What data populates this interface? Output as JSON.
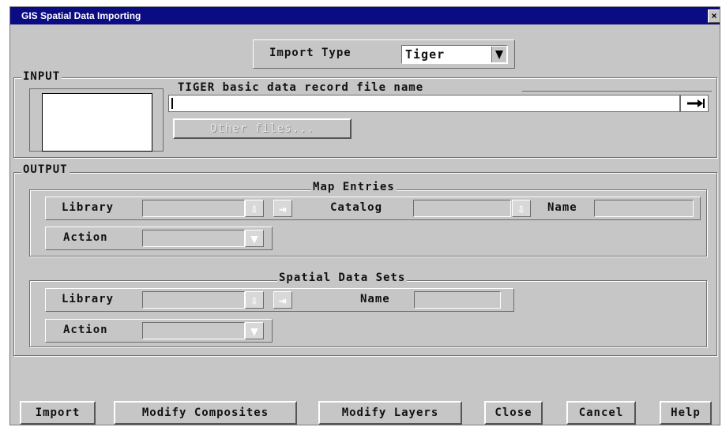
{
  "window": {
    "title": "GIS Spatial Data Importing",
    "close_glyph": "×"
  },
  "import_type": {
    "label": "Import Type",
    "value": "Tiger"
  },
  "input": {
    "group_label": "INPUT",
    "file_label": "TIGER basic data record file name",
    "file_value": "",
    "other_files_label": "Other files..."
  },
  "output": {
    "group_label": "OUTPUT",
    "map_entries": {
      "title": "Map Entries",
      "library_label": "Library",
      "catalog_label": "Catalog",
      "name_label": "Name",
      "action_label": "Action"
    },
    "spatial_data_sets": {
      "title": "Spatial Data Sets",
      "library_label": "Library",
      "name_label": "Name",
      "action_label": "Action"
    }
  },
  "buttons": {
    "import": "Import",
    "modify_composites": "Modify Composites",
    "modify_layers": "Modify Layers",
    "close": "Close",
    "cancel": "Cancel",
    "help": "Help"
  },
  "icons": {
    "dropdown": "triangle-down-icon",
    "down_arrow": "arrow-down-icon",
    "right_arrow": "arrow-right-icon"
  }
}
